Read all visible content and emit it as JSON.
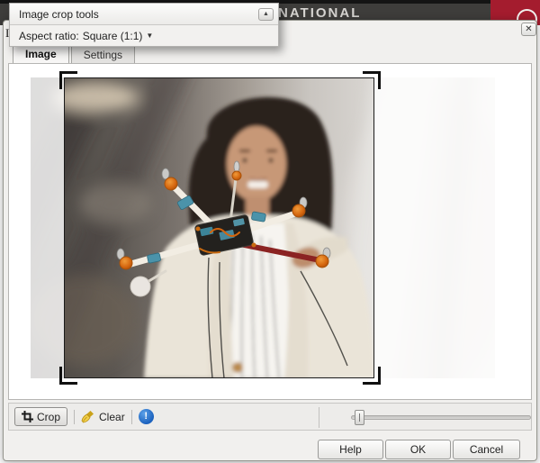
{
  "header": {
    "brand_text": "NATIONAL",
    "bar_color": "#3e3d3b",
    "accent_color": "#a41c2e",
    "search_icon": "magnifier-ring"
  },
  "crop_tools_panel": {
    "title": "Image crop tools",
    "collapse_icon": "collapse-up-arrow",
    "collapse_glyph": "▲",
    "aspect_label": "Aspect ratio:",
    "aspect_value": "Square (1:1)",
    "dropdown_glyph": "▼"
  },
  "dialog": {
    "title_fragment": "I",
    "close_glyph": "✕",
    "tabs": [
      {
        "label": "Image",
        "active": true
      },
      {
        "label": "Settings",
        "active": false
      }
    ],
    "toolbar": {
      "crop_label": "Crop",
      "clear_label": "Clear",
      "info_glyph": "!",
      "slider": {
        "percent": 2
      }
    },
    "footer_buttons": {
      "help": "Help",
      "ok": "OK",
      "cancel": "Cancel"
    }
  },
  "photo": {
    "alt": "Smiling woman with long dark hair in a cream blazer holding a homemade quadcopter drone",
    "crop_aspect": "1:1",
    "colors": {
      "background_left": "#4a4642",
      "background_right": "#e9e7e4",
      "hair": "#2c241e",
      "skin": "#c79877",
      "blazer": "#eae4d8",
      "drone_accent": "#d4650e",
      "drone_arm_red": "#8b2322",
      "drone_pcb_teal": "#4b93aa"
    }
  }
}
